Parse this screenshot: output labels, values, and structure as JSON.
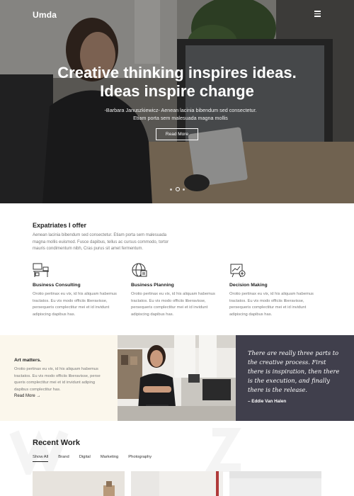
{
  "header": {
    "brand": "Umda",
    "menu_icon": "hamburger-icon"
  },
  "hero": {
    "title_line1": "Creative thinking inspires ideas.",
    "title_line2": "Ideas inspire change",
    "subtitle": "-Barbara Januszkiewicz- Aenean lacinia bibendum sed consectetur. Etiam porta sem malesuada magna mollis",
    "button": "Read More",
    "slides": 3,
    "active_slide": 2
  },
  "expertise": {
    "title": "Expatriates I offer",
    "body": "Aenean lacinia bibendum sed consectetur. Etiam porta sem malesuada magna mollis euismod. Fusce dapibus, tellus ac cursus commodo, tortor mauris condimentum nibh, Cras purus sit amet fermentum.",
    "services": [
      {
        "icon": "workspace-desk-icon",
        "title": "Business Consulting",
        "body": "Orotio pertinax eu vix, id his aliquam habemus tractatos. Eu vis modo officiis liberavisse, persequeris complectitur mei et id invidunt adipiscing dapibus has."
      },
      {
        "icon": "globe-planning-icon",
        "title": "Business Planning",
        "body": "Orotio pertinax eu vix, id his aliquam habemus tractatos. Eu vis modo officiis liberavisse, persequeris complectitur mei et id invidunt adipiscing dapibus has."
      },
      {
        "icon": "decision-board-icon",
        "title": "Decision Making",
        "body": "Orotio pertinax eu vix, id his aliquam habemus tractatos. Eu vis modo officiis liberavisse, persequeris complectitur mei et id invidunt adipiscing dapibus has."
      }
    ]
  },
  "art": {
    "title": "Art matters.",
    "body": "Orotio pertinax eu vix, id his aliquam habemus tractatos. Eu vis modo officiis liberavisse, perse queris complectitur mei et id invidunt adiping dapibus complectitur has.",
    "link": "Read More →"
  },
  "quote": {
    "text": "There are really three parts to the creative process. First there is inspiration, then there is the execution, and finally there is the release.",
    "author": "– Eddie Van Halen"
  },
  "recent_work": {
    "title": "Recent Work",
    "filters": [
      "Show All",
      "Brand",
      "Digital",
      "Marketing",
      "Photography"
    ],
    "active_filter": "Show All"
  },
  "colors": {
    "accent_dark": "#403f4c",
    "cream": "#fbf7ec",
    "text_muted": "#777777"
  }
}
